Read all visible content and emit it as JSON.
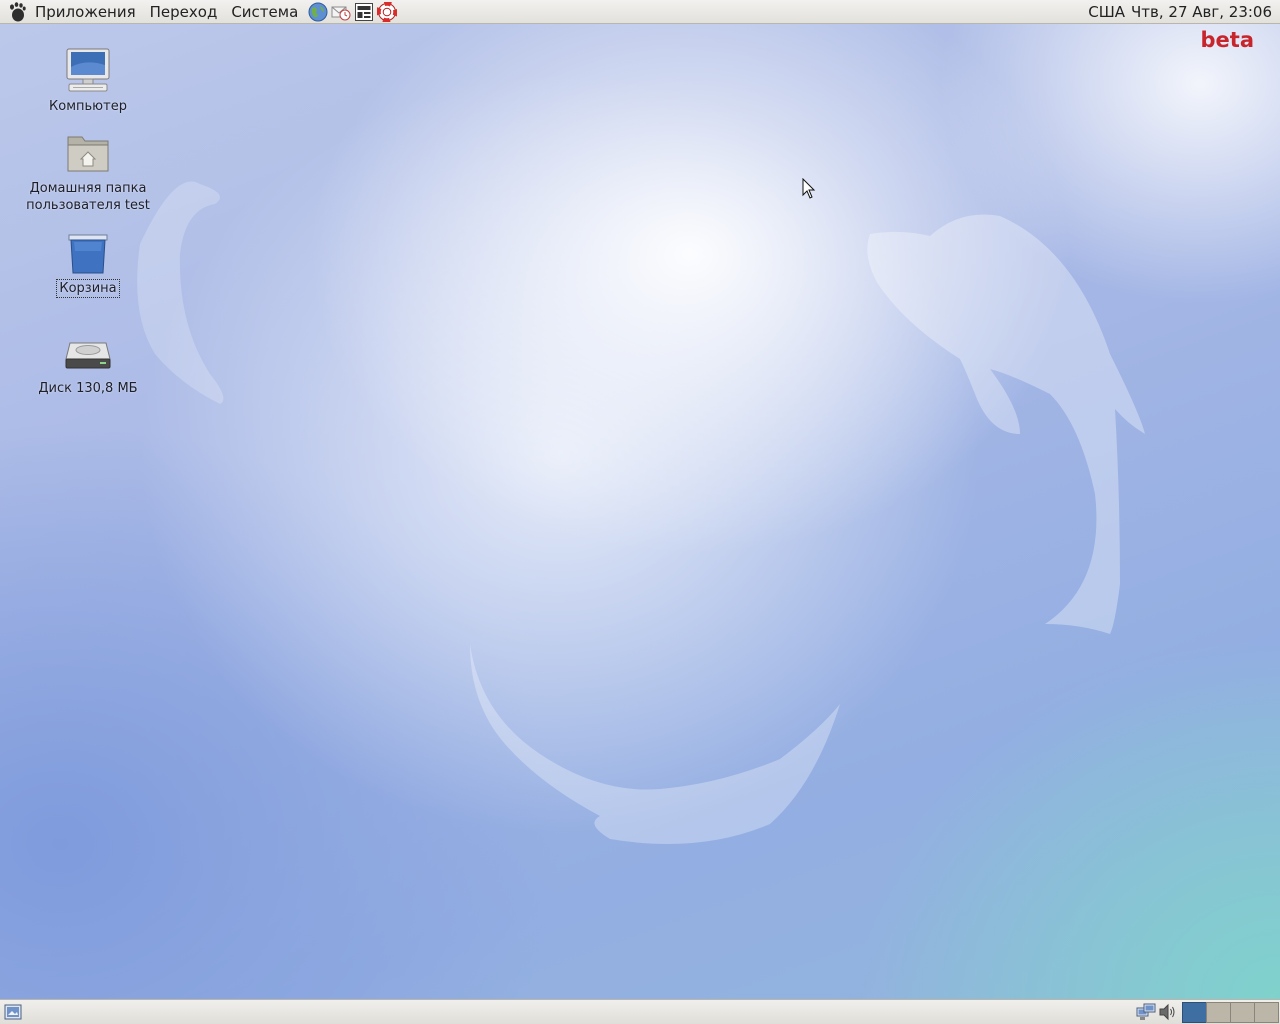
{
  "top_panel": {
    "menus": [
      "Приложения",
      "Переход",
      "Система"
    ],
    "launchers": [
      "browser-icon",
      "mail-clock-icon",
      "notes-icon",
      "help-lifebuoy-icon"
    ],
    "keyboard_layout": "США",
    "clock": "Чтв, 27 Авг, 23:06"
  },
  "desktop": {
    "badge": "beta",
    "icons": [
      {
        "label": "Компьютер",
        "icon": "computer-icon"
      },
      {
        "label": "Домашняя папка\nпользователя test",
        "icon": "home-folder-icon"
      },
      {
        "label": "Корзина",
        "icon": "trash-icon",
        "selected": true
      },
      {
        "label": "Диск 130,8 МБ",
        "icon": "disk-drive-icon"
      }
    ]
  },
  "bottom_panel": {
    "tray_icons": [
      "network-icon",
      "volume-icon"
    ],
    "workspaces": [
      {
        "index": 1,
        "active": true
      },
      {
        "index": 2,
        "active": false
      },
      {
        "index": 3,
        "active": false
      },
      {
        "index": 4,
        "active": false
      }
    ]
  },
  "colors": {
    "badge": "#c8242c",
    "active_workspace": "#3f6fa2"
  }
}
